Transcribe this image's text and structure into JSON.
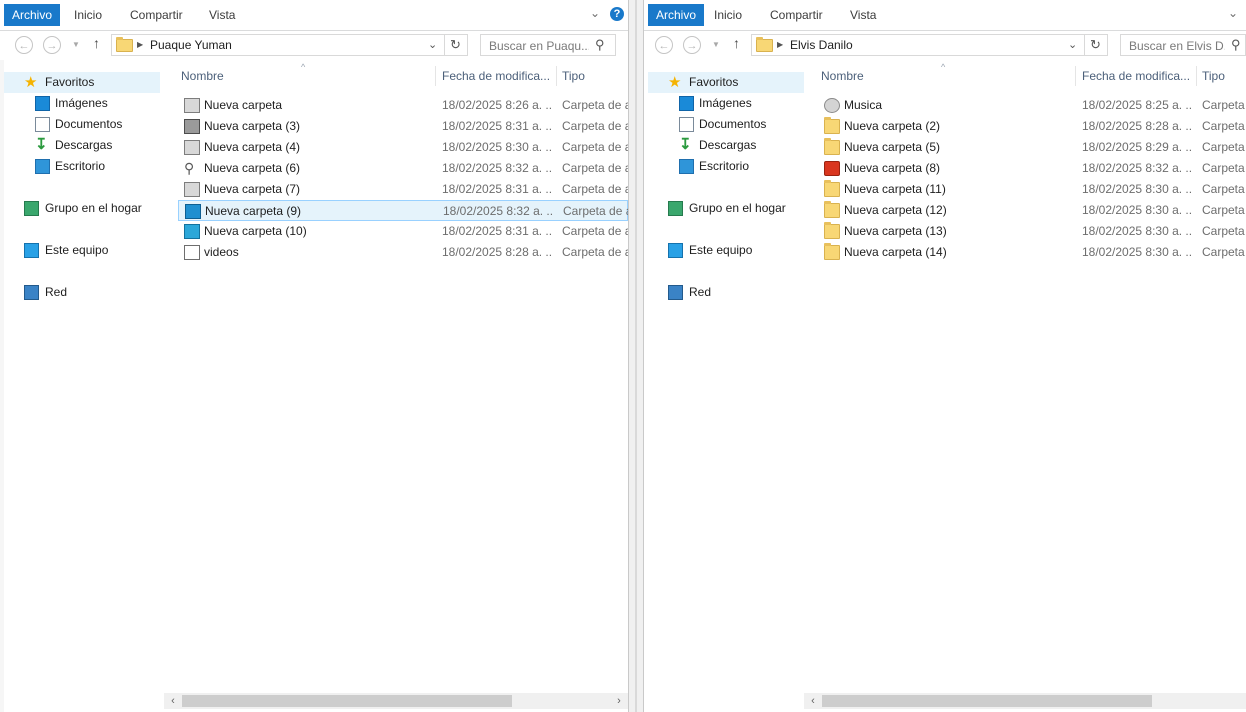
{
  "left": {
    "tabs": {
      "file": "Archivo",
      "home": "Inicio",
      "share": "Compartir",
      "view": "Vista"
    },
    "help_glyph": "?",
    "address": {
      "path": "Puaque Yuman"
    },
    "search": {
      "placeholder": "Buscar en Puaqu..."
    },
    "sidebar": {
      "favorites": "Favoritos",
      "pictures": "Imágenes",
      "documents": "Documentos",
      "downloads": "Descargas",
      "desktop": "Escritorio",
      "homegroup": "Grupo en el hogar",
      "this_pc": "Este equipo",
      "network": "Red"
    },
    "columns": {
      "name": "Nombre",
      "date": "Fecha de modifica...",
      "type": "Tipo"
    },
    "files": [
      {
        "name": "Nueva carpeta",
        "date": "18/02/2025 8:26 a. ...",
        "type": "Carpeta de a",
        "icon": "drive-icon"
      },
      {
        "name": "Nueva carpeta (3)",
        "date": "18/02/2025 8:31 a. ...",
        "type": "Carpeta de a",
        "icon": "printer-icon"
      },
      {
        "name": "Nueva carpeta (4)",
        "date": "18/02/2025 8:30 a. ...",
        "type": "Carpeta de a",
        "icon": "drive-icon"
      },
      {
        "name": "Nueva carpeta (6)",
        "date": "18/02/2025 8:32 a. ...",
        "type": "Carpeta de a",
        "icon": "magnifier-icon"
      },
      {
        "name": "Nueva carpeta (7)",
        "date": "18/02/2025 8:31 a. ...",
        "type": "Carpeta de a",
        "icon": "network-drive-icon"
      },
      {
        "name": "Nueva carpeta (9)",
        "date": "18/02/2025 8:32 a. ...",
        "type": "Carpeta de a",
        "icon": "monitor-icon"
      },
      {
        "name": "Nueva carpeta (10)",
        "date": "18/02/2025 8:31 a. ...",
        "type": "Carpeta de a",
        "icon": "screen-icon"
      },
      {
        "name": "videos",
        "date": "18/02/2025 8:28 a. ...",
        "type": "Carpeta de a",
        "icon": "file-icon"
      }
    ],
    "selected_index": 5
  },
  "right": {
    "tabs": {
      "file": "Archivo",
      "home": "Inicio",
      "share": "Compartir",
      "view": "Vista"
    },
    "address": {
      "path": "Elvis Danilo"
    },
    "search": {
      "placeholder": "Buscar en Elvis D..."
    },
    "sidebar": {
      "favorites": "Favoritos",
      "pictures": "Imágenes",
      "documents": "Documentos",
      "downloads": "Descargas",
      "desktop": "Escritorio",
      "homegroup": "Grupo en el hogar",
      "this_pc": "Este equipo",
      "network": "Red"
    },
    "columns": {
      "name": "Nombre",
      "date": "Fecha de modifica...",
      "type": "Tipo"
    },
    "files": [
      {
        "name": "Musica",
        "date": "18/02/2025 8:25 a. ...",
        "type": "Carpeta",
        "icon": "cd-icon"
      },
      {
        "name": "Nueva carpeta (2)",
        "date": "18/02/2025 8:28 a. ...",
        "type": "Carpeta",
        "icon": "folder-icon"
      },
      {
        "name": "Nueva carpeta (5)",
        "date": "18/02/2025 8:29 a. ...",
        "type": "Carpeta",
        "icon": "folder-icon"
      },
      {
        "name": "Nueva carpeta (8)",
        "date": "18/02/2025 8:32 a. ...",
        "type": "Carpeta",
        "icon": "office-icon"
      },
      {
        "name": "Nueva carpeta (11)",
        "date": "18/02/2025 8:30 a. ...",
        "type": "Carpeta",
        "icon": "folder-icon"
      },
      {
        "name": "Nueva carpeta (12)",
        "date": "18/02/2025 8:30 a. ...",
        "type": "Carpeta",
        "icon": "folder-icon"
      },
      {
        "name": "Nueva carpeta (13)",
        "date": "18/02/2025 8:30 a. ...",
        "type": "Carpeta",
        "icon": "folder-icon"
      },
      {
        "name": "Nueva carpeta (14)",
        "date": "18/02/2025 8:30 a. ...",
        "type": "Carpeta",
        "icon": "folder-icon"
      }
    ]
  },
  "colors": {
    "accent": "#1979ca",
    "selection": "#e5f3fb",
    "selection_border": "#99d1ff",
    "header_text": "#4c607a"
  }
}
